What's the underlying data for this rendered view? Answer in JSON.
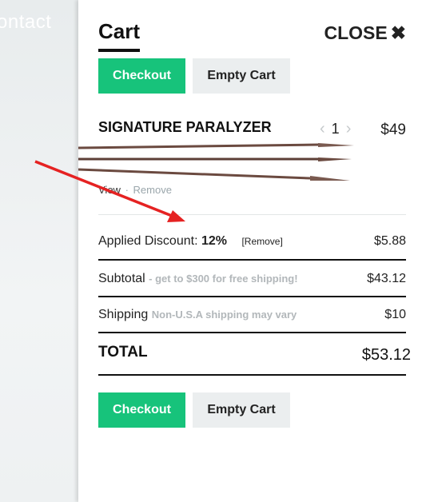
{
  "background": {
    "nav_text": "ontact"
  },
  "cart": {
    "title": "Cart",
    "close_label": "CLOSE",
    "checkout_label": "Checkout",
    "empty_label": "Empty Cart"
  },
  "item": {
    "name": "SIGNATURE PARALYZER",
    "quantity": "1",
    "price": "$49",
    "view_label": "View",
    "separator": "·",
    "remove_label": "Remove"
  },
  "discount": {
    "label": "Applied Discount:",
    "percent": "12%",
    "remove_label": "[Remove]",
    "value": "$5.88"
  },
  "subtotal": {
    "label": "Subtotal",
    "note": "- get to $300 for free shipping!",
    "value": "$43.12"
  },
  "shipping": {
    "label": "Shipping",
    "note": "Non-U.S.A shipping may vary",
    "value": "$10"
  },
  "total": {
    "label": "TOTAL",
    "value": "$53.12"
  },
  "colors": {
    "checkout": "#17c37b",
    "empty": "#ebeeef",
    "arrow": "#e52222"
  }
}
